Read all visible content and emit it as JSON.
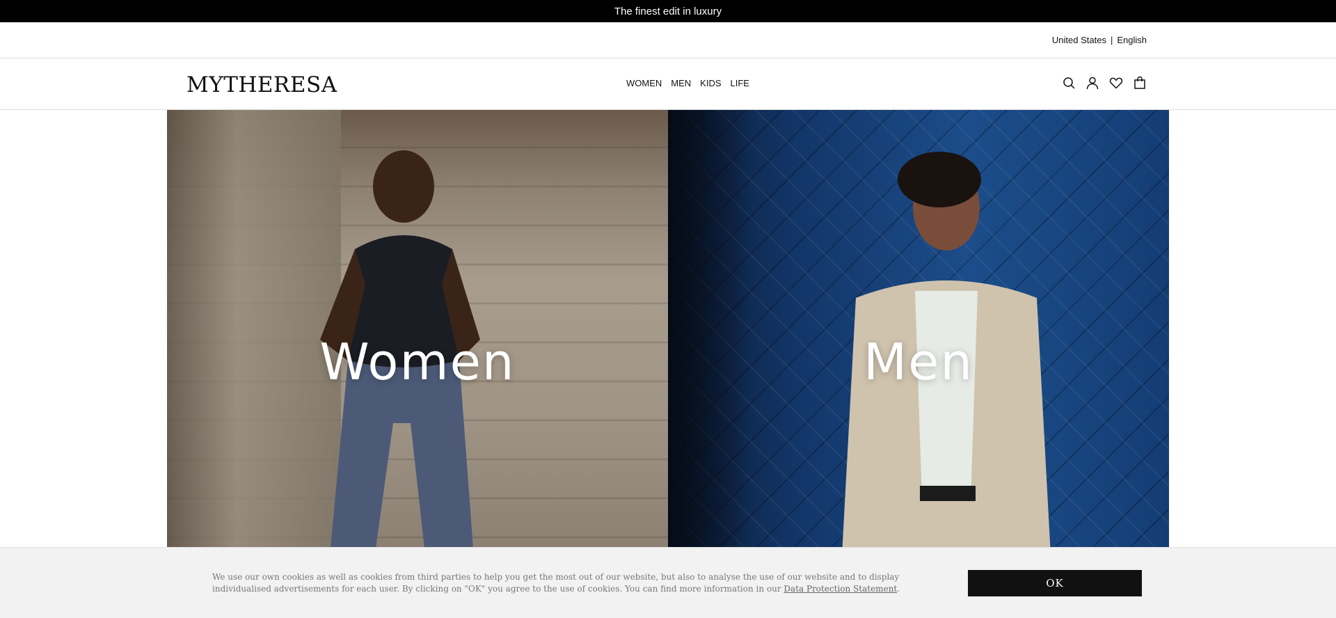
{
  "promo": {
    "text": "The finest edit in luxury"
  },
  "locale": {
    "country": "United States",
    "separator": "|",
    "language": "English"
  },
  "header": {
    "logo": "MYTHERESA",
    "nav": [
      "WOMEN",
      "MEN",
      "KIDS",
      "LIFE"
    ],
    "icons": [
      "search-icon",
      "account-icon",
      "wishlist-icon",
      "bag-icon"
    ]
  },
  "hero": {
    "women_label": "Women",
    "men_label": "Men"
  },
  "cookie": {
    "text": "We use our own cookies as well as cookies from third parties to help you get the most out of our website, but also to analyse the use of our website and to display individualised advertisements for each user. By clicking on \"OK\" you agree to the use of cookies. You can find more information in our ",
    "link_text": "Data Protection Statement",
    "suffix": ".",
    "ok_label": "OK"
  }
}
